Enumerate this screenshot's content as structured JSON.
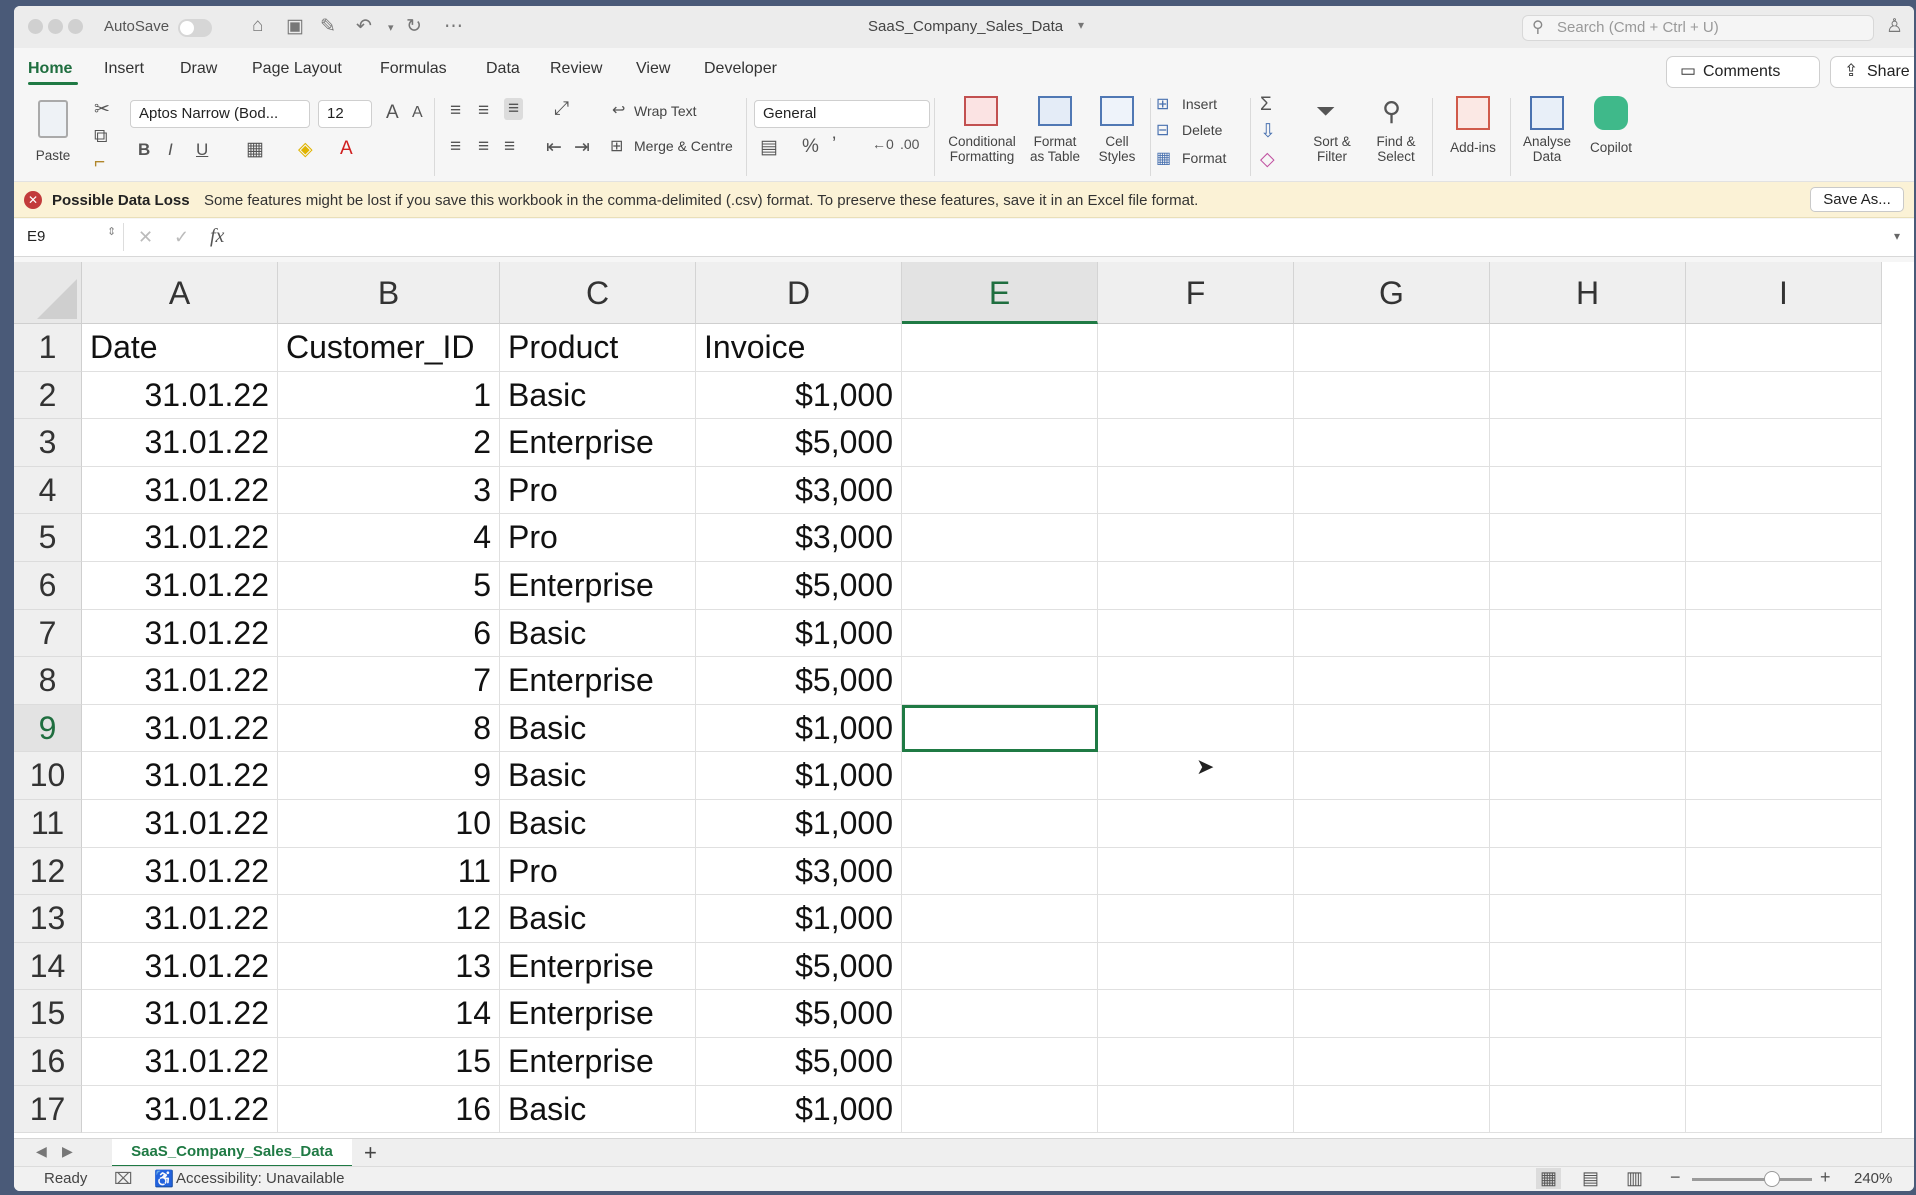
{
  "titlebar": {
    "autosave": "AutoSave",
    "document": "SaaS_Company_Sales_Data",
    "search_placeholder": "Search (Cmd + Ctrl + U)"
  },
  "tabs": [
    "Home",
    "Insert",
    "Draw",
    "Page Layout",
    "Formulas",
    "Data",
    "Review",
    "View",
    "Developer"
  ],
  "active_tab": "Home",
  "buttons": {
    "comments": "Comments",
    "share": "Share"
  },
  "ribbon": {
    "paste": "Paste",
    "font_name": "Aptos Narrow (Bod...",
    "font_size": "12",
    "bold": "B",
    "italic": "I",
    "underline": "U",
    "wrap_text": "Wrap Text",
    "merge_centre": "Merge & Centre",
    "number_format": "General",
    "percent": "%",
    "comma": "’",
    "cond_format": [
      "Conditional",
      "Formatting"
    ],
    "format_table": [
      "Format",
      "as Table"
    ],
    "cell_styles": [
      "Cell",
      "Styles"
    ],
    "insert": "Insert",
    "delete": "Delete",
    "format": "Format",
    "sort_filter": [
      "Sort &",
      "Filter"
    ],
    "find_select": [
      "Find &",
      "Select"
    ],
    "addins": "Add-ins",
    "analyse": [
      "Analyse",
      "Data"
    ],
    "copilot": "Copilot"
  },
  "message": {
    "title": "Possible Data Loss",
    "text": "Some features might be lost if you save this workbook in the comma-delimited (.csv) format. To preserve these features, save it in an Excel file format.",
    "button": "Save As..."
  },
  "formula_bar": {
    "name_box": "E9",
    "fx": "fx",
    "content": ""
  },
  "sheet": {
    "columns": [
      "A",
      "B",
      "C",
      "D",
      "E",
      "F",
      "G",
      "H",
      "I"
    ],
    "selected_column": "E",
    "selected_row": "9",
    "rows": [
      {
        "n": "1",
        "a": "Date",
        "b": "Customer_ID",
        "c": "Product",
        "d": "Invoice"
      },
      {
        "n": "2",
        "a": "31.01.22",
        "b": "1",
        "c": "Basic",
        "d": "$1,000"
      },
      {
        "n": "3",
        "a": "31.01.22",
        "b": "2",
        "c": "Enterprise",
        "d": "$5,000"
      },
      {
        "n": "4",
        "a": "31.01.22",
        "b": "3",
        "c": "Pro",
        "d": "$3,000"
      },
      {
        "n": "5",
        "a": "31.01.22",
        "b": "4",
        "c": "Pro",
        "d": "$3,000"
      },
      {
        "n": "6",
        "a": "31.01.22",
        "b": "5",
        "c": "Enterprise",
        "d": "$5,000"
      },
      {
        "n": "7",
        "a": "31.01.22",
        "b": "6",
        "c": "Basic",
        "d": "$1,000"
      },
      {
        "n": "8",
        "a": "31.01.22",
        "b": "7",
        "c": "Enterprise",
        "d": "$5,000"
      },
      {
        "n": "9",
        "a": "31.01.22",
        "b": "8",
        "c": "Basic",
        "d": "$1,000"
      },
      {
        "n": "10",
        "a": "31.01.22",
        "b": "9",
        "c": "Basic",
        "d": "$1,000"
      },
      {
        "n": "11",
        "a": "31.01.22",
        "b": "10",
        "c": "Basic",
        "d": "$1,000"
      },
      {
        "n": "12",
        "a": "31.01.22",
        "b": "11",
        "c": "Pro",
        "d": "$3,000"
      },
      {
        "n": "13",
        "a": "31.01.22",
        "b": "12",
        "c": "Basic",
        "d": "$1,000"
      },
      {
        "n": "14",
        "a": "31.01.22",
        "b": "13",
        "c": "Enterprise",
        "d": "$5,000"
      },
      {
        "n": "15",
        "a": "31.01.22",
        "b": "14",
        "c": "Enterprise",
        "d": "$5,000"
      },
      {
        "n": "16",
        "a": "31.01.22",
        "b": "15",
        "c": "Enterprise",
        "d": "$5,000"
      },
      {
        "n": "17",
        "a": "31.01.22",
        "b": "16",
        "c": "Basic",
        "d": "$1,000"
      }
    ]
  },
  "sheet_tab": "SaaS_Company_Sales_Data",
  "status": {
    "ready": "Ready",
    "accessibility": "Accessibility: Unavailable",
    "zoom": "240%"
  },
  "colors": {
    "accent": "#1f7a44",
    "warning_bg": "#fbf2d6"
  }
}
